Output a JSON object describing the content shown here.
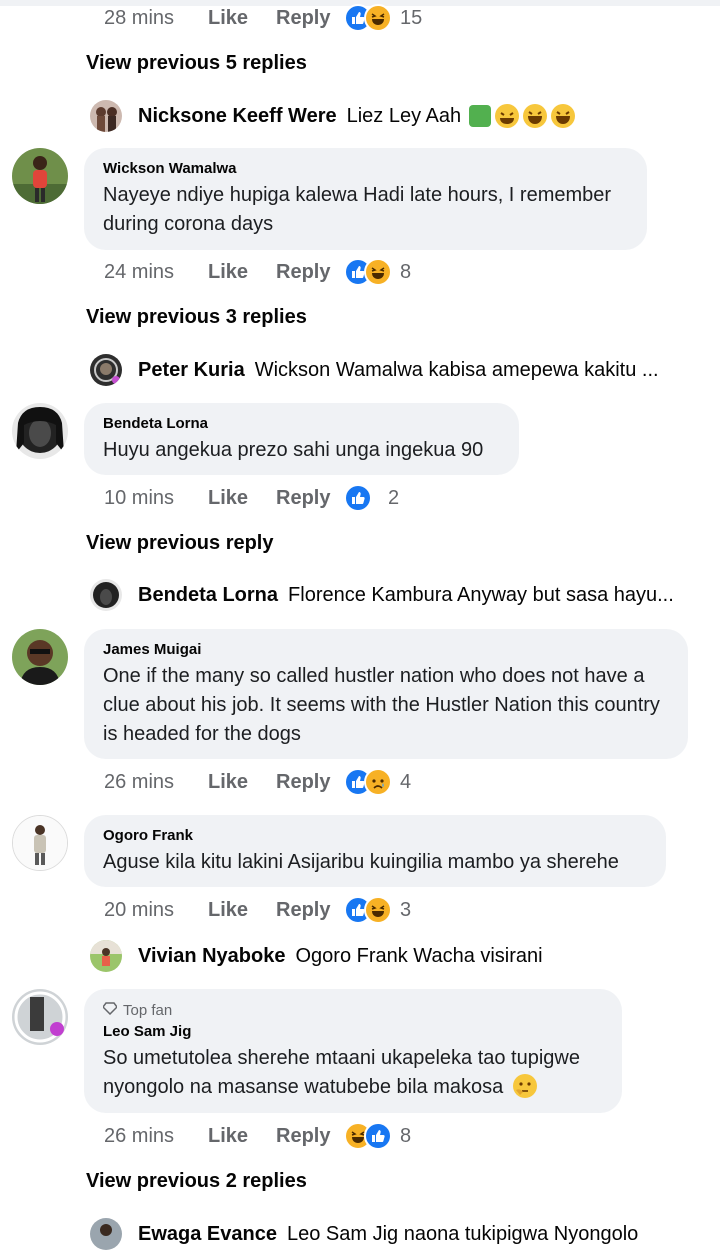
{
  "comments": [
    {
      "time": "28 mins",
      "like": "Like",
      "reply": "Reply",
      "count": "15"
    },
    {
      "author": "Wickson Wamalwa",
      "text": "Nayeye ndiye hupiga kalewa Hadi late hours, I remember during corona days",
      "time": "24 mins",
      "like": "Like",
      "reply": "Reply",
      "count": "8"
    },
    {
      "author": "Bendeta Lorna",
      "text": "Huyu angekua prezo sahi unga ingekua 90",
      "time": "10 mins",
      "like": "Like",
      "reply": "Reply",
      "count": "2"
    },
    {
      "author": "James Muigai",
      "text": "One if the many so called hustler nation who does not have a clue about his job. It seems with the Hustler Nation this country is headed for the dogs",
      "time": "26 mins",
      "like": "Like",
      "reply": "Reply",
      "count": "4"
    },
    {
      "author": "Ogoro Frank",
      "text": "Aguse kila kitu lakini Asijaribu kuingilia mambo ya sherehe",
      "time": "20 mins",
      "like": "Like",
      "reply": "Reply",
      "count": "3"
    },
    {
      "badge": "Top fan",
      "author": "Leo Sam Jig",
      "text": "So umetutolea sherehe mtaani ukapeleka tao tupigwe nyongolo na masanse watubebe bila makosa",
      "time": "26 mins",
      "like": "Like",
      "reply": "Reply",
      "count": "8"
    }
  ],
  "view_previous": [
    "View previous 5 replies",
    "View previous 3 replies",
    "View previous reply",
    "View previous 2 replies"
  ],
  "replies": [
    {
      "name": "Nicksone Keeff Were",
      "text": "Liez Ley Aah"
    },
    {
      "name": "Peter Kuria",
      "text": "Wickson Wamalwa kabisa amepewa kakitu ..."
    },
    {
      "name": "Bendeta Lorna",
      "text": "Florence Kambura Anyway but sasa hayu..."
    },
    {
      "name": "Vivian Nyaboke",
      "text": "Ogoro Frank Wacha visirani"
    },
    {
      "name": "Ewaga Evance",
      "text": "Leo Sam Jig naona tukipigwa Nyongolo"
    }
  ],
  "colors": {
    "like_blue": "#1877f2",
    "bubble": "#f0f2f5",
    "secondary": "#65676b"
  }
}
